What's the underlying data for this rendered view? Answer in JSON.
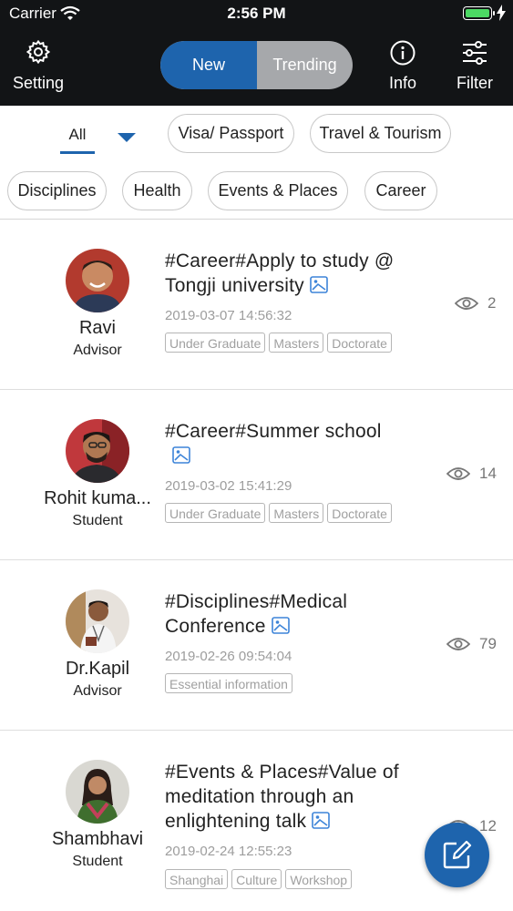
{
  "status_bar": {
    "carrier": "Carrier",
    "time": "2:56 PM"
  },
  "header": {
    "setting_label": "Setting",
    "segment": {
      "new_label": "New",
      "trending_label": "Trending",
      "selected": "New"
    },
    "info_label": "Info",
    "filter_label": "Filter"
  },
  "filters": {
    "all_label": "All",
    "chips": [
      "Visa/ Passport",
      "Travel & Tourism",
      "Disciplines",
      "Health",
      "Events & Places",
      "Career"
    ]
  },
  "posts": [
    {
      "name": "Ravi",
      "role": "Advisor",
      "title": "#Career#Apply to study @ Tongji university",
      "date": "2019-03-07 14:56:32",
      "tags": [
        "Under Graduate",
        "Masters",
        "Doctorate"
      ],
      "views": "2"
    },
    {
      "name": "Rohit kuma...",
      "role": "Student",
      "title": "#Career#Summer school",
      "date": "2019-03-02 15:41:29",
      "tags": [
        "Under Graduate",
        "Masters",
        "Doctorate"
      ],
      "views": "14"
    },
    {
      "name": "Dr.Kapil",
      "role": "Advisor",
      "title": "#Disciplines#Medical Conference",
      "date": "2019-02-26 09:54:04",
      "tags": [
        "Essential information"
      ],
      "views": "79"
    },
    {
      "name": "Shambhavi",
      "role": "Student",
      "title": "#Events & Places#Value of meditation through an enlightening talk",
      "date": "2019-02-24 12:55:23",
      "tags": [
        "Shanghai",
        "Culture",
        "Workshop"
      ],
      "views": "12"
    }
  ],
  "colors": {
    "accent": "#1e64ad",
    "header_bg": "#121416",
    "battery": "#4cd964"
  },
  "icons": {
    "setting": "gear-icon",
    "info": "info-icon",
    "filter": "sliders-icon",
    "views": "eye-icon",
    "image": "image-icon",
    "compose": "compose-icon"
  }
}
